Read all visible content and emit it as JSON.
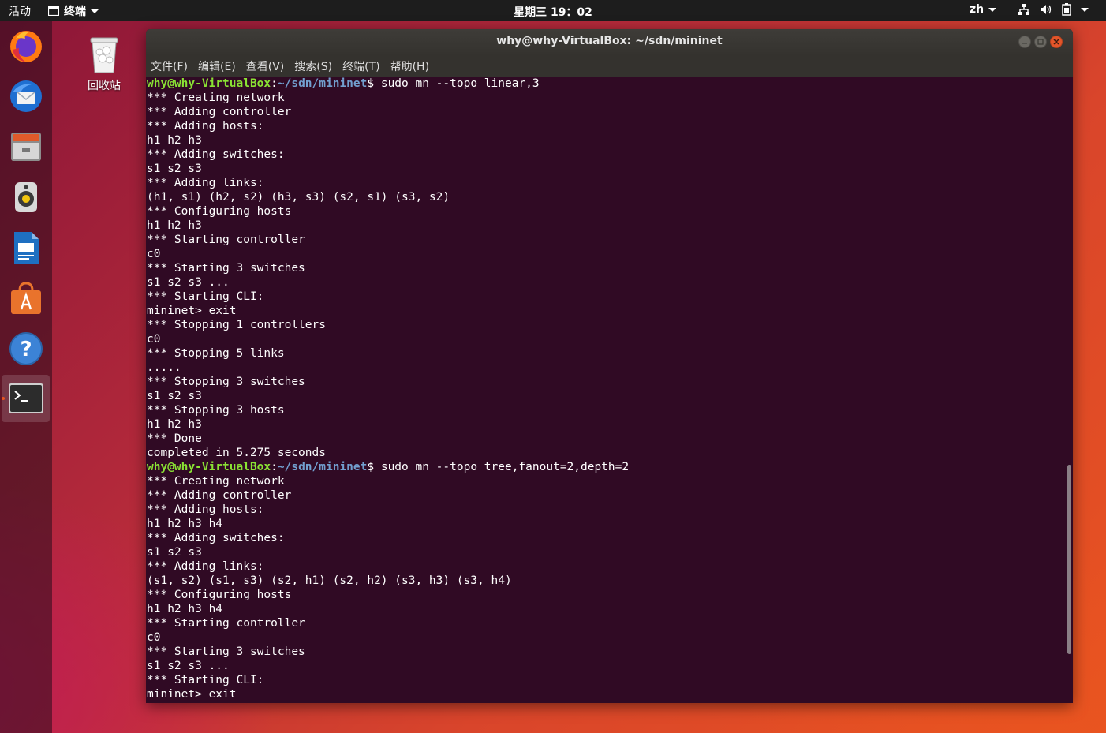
{
  "topbar": {
    "activities": "活动",
    "app_name": "终端",
    "clock": "星期三 19：02",
    "lang": "zh"
  },
  "desktop": {
    "trash_label": "回收站"
  },
  "window": {
    "title": "why@why-VirtualBox: ~/sdn/mininet",
    "menu": [
      "文件(F)",
      "编辑(E)",
      "查看(V)",
      "搜索(S)",
      "终端(T)",
      "帮助(H)"
    ]
  },
  "terminal": {
    "prompt_user": "why@why-VirtualBox",
    "prompt_path": "~/sdn/mininet",
    "commands": [
      "sudo mn --topo linear,3",
      "sudo mn --topo tree,fanout=2,depth=2"
    ],
    "output1": [
      "*** Creating network",
      "*** Adding controller",
      "*** Adding hosts:",
      "h1 h2 h3",
      "*** Adding switches:",
      "s1 s2 s3",
      "*** Adding links:",
      "(h1, s1) (h2, s2) (h3, s3) (s2, s1) (s3, s2)",
      "*** Configuring hosts",
      "h1 h2 h3",
      "*** Starting controller",
      "c0",
      "*** Starting 3 switches",
      "s1 s2 s3 ...",
      "*** Starting CLI:",
      "mininet> exit",
      "*** Stopping 1 controllers",
      "c0",
      "*** Stopping 5 links",
      ".....",
      "*** Stopping 3 switches",
      "s1 s2 s3",
      "*** Stopping 3 hosts",
      "h1 h2 h3",
      "*** Done",
      "completed in 5.275 seconds"
    ],
    "output2": [
      "*** Creating network",
      "*** Adding controller",
      "*** Adding hosts:",
      "h1 h2 h3 h4",
      "*** Adding switches:",
      "s1 s2 s3",
      "*** Adding links:",
      "(s1, s2) (s1, s3) (s2, h1) (s2, h2) (s3, h3) (s3, h4)",
      "*** Configuring hosts",
      "h1 h2 h3 h4",
      "*** Starting controller",
      "c0",
      "*** Starting 3 switches",
      "s1 s2 s3 ...",
      "*** Starting CLI:",
      "mininet> exit"
    ]
  },
  "dock": {
    "items": [
      "firefox-icon",
      "thunderbird-icon",
      "files-icon",
      "rhythmbox-icon",
      "writer-icon",
      "software-center-icon",
      "help-icon",
      "terminal-icon"
    ]
  },
  "colors": {
    "terminal_bg": "#300a24",
    "prompt_user": "#8ae234",
    "prompt_path": "#729fcf",
    "accent": "#e95420"
  }
}
